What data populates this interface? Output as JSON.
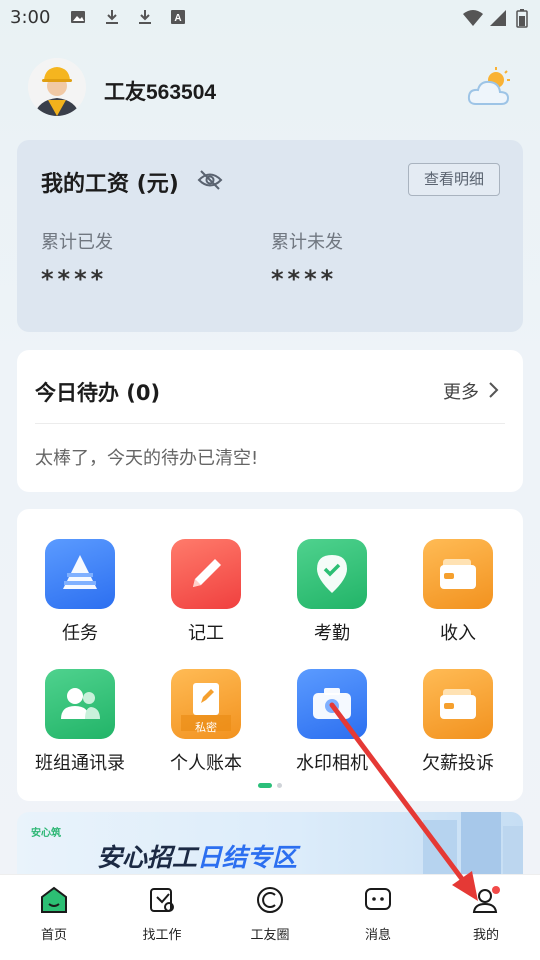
{
  "status_bar": {
    "time": "3:00",
    "left_icons": [
      "image-icon",
      "download-icon",
      "download-icon",
      "font-a-icon"
    ],
    "right_icons": [
      "wifi-icon",
      "signal-icon",
      "battery-icon"
    ]
  },
  "header": {
    "username": "工友563504",
    "weather_icon": "cloud-sun-icon"
  },
  "salary": {
    "title": "我的工资 (元)",
    "detail_button": "查看明细",
    "paid_label": "累计已发",
    "paid_value": "****",
    "unpaid_label": "累计未发",
    "unpaid_value": "****"
  },
  "todo": {
    "title": "今日待办 (0)",
    "more": "更多",
    "empty_text": "太棒了，今天的待办已清空!"
  },
  "grid": {
    "items": [
      {
        "label": "任务",
        "icon": "task-icon",
        "color": "#3a7cf2"
      },
      {
        "label": "记工",
        "icon": "pencil-icon",
        "color": "#f24a49"
      },
      {
        "label": "考勤",
        "icon": "location-check-icon",
        "color": "#2cbf74"
      },
      {
        "label": "收入",
        "icon": "wallet-icon",
        "color": "#f5a02e"
      },
      {
        "label": "班组通讯录",
        "icon": "contacts-icon",
        "color": "#2cbf74"
      },
      {
        "label": "个人账本",
        "icon": "ledger-icon",
        "color": "#f5a02e",
        "badge": "私密"
      },
      {
        "label": "水印相机",
        "icon": "camera-icon",
        "color": "#3a7cf2"
      },
      {
        "label": "欠薪投诉",
        "icon": "wallet-icon",
        "color": "#f5a02e"
      }
    ],
    "page_count": 2,
    "active_page": 1
  },
  "banner": {
    "logo_text": "安心筑",
    "title_main": "安心招工",
    "title_accent": "日结专区"
  },
  "bottom_nav": {
    "items": [
      {
        "label": "首页",
        "icon": "home-icon",
        "active": true
      },
      {
        "label": "找工作",
        "icon": "find-job-icon",
        "active": false
      },
      {
        "label": "工友圈",
        "icon": "circle-icon",
        "active": false
      },
      {
        "label": "消息",
        "icon": "message-icon",
        "active": false
      },
      {
        "label": "我的",
        "icon": "profile-icon",
        "active": false,
        "has_badge": true
      }
    ]
  },
  "colors": {
    "accent_green": "#2cbf74",
    "accent_blue": "#2c6ff0",
    "annotation_arrow": "#e53935"
  }
}
